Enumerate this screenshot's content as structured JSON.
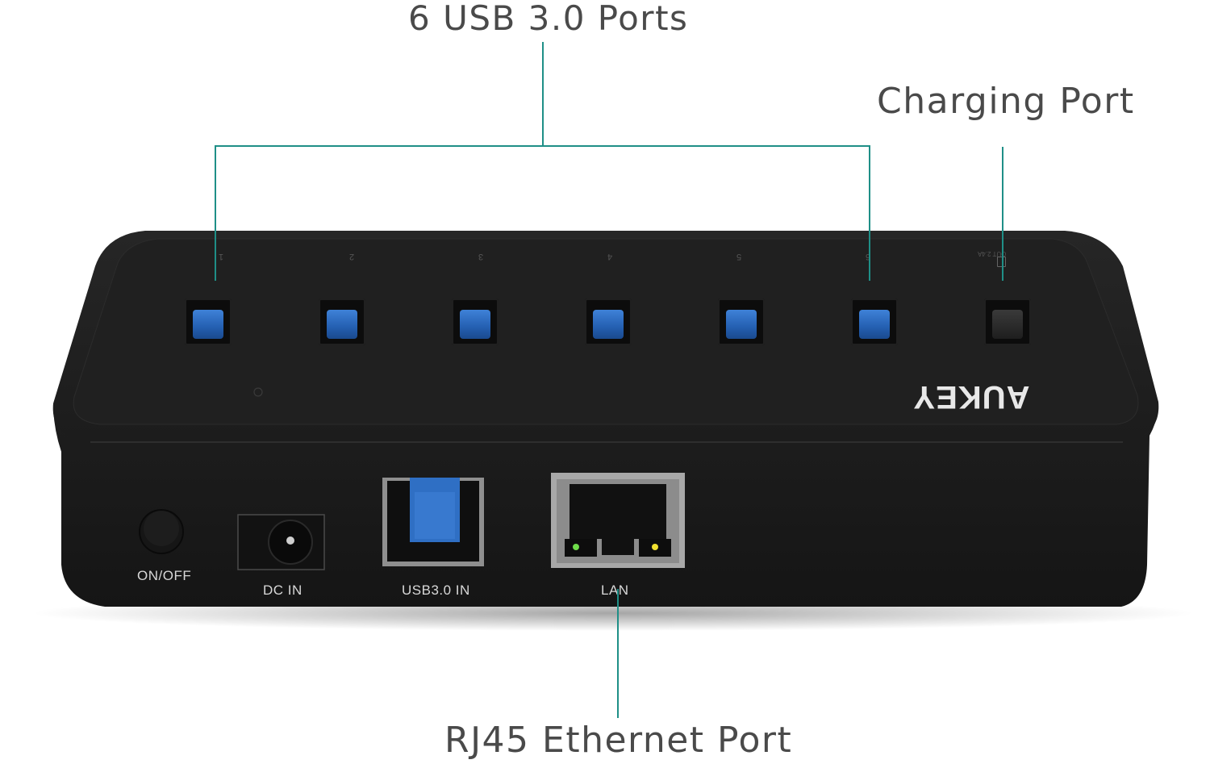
{
  "callouts": {
    "usb_ports": "6 USB 3.0 Ports",
    "charging_port": "Charging Port",
    "ethernet_port": "RJ45 Ethernet Port"
  },
  "hub": {
    "brand": "AUKEY",
    "port_numbers": [
      "1",
      "2",
      "3",
      "4",
      "5",
      "6"
    ],
    "charging_port_label": "OUT 2.4A",
    "rear": {
      "power_switch": "ON/OFF",
      "dc_input": "DC IN",
      "usb_input": "USB3.0 IN",
      "lan": "LAN"
    }
  },
  "colors": {
    "callout_line": "#1f8f87",
    "usb3_blue": "#2f6fc4",
    "body": "#1b1b1b"
  }
}
